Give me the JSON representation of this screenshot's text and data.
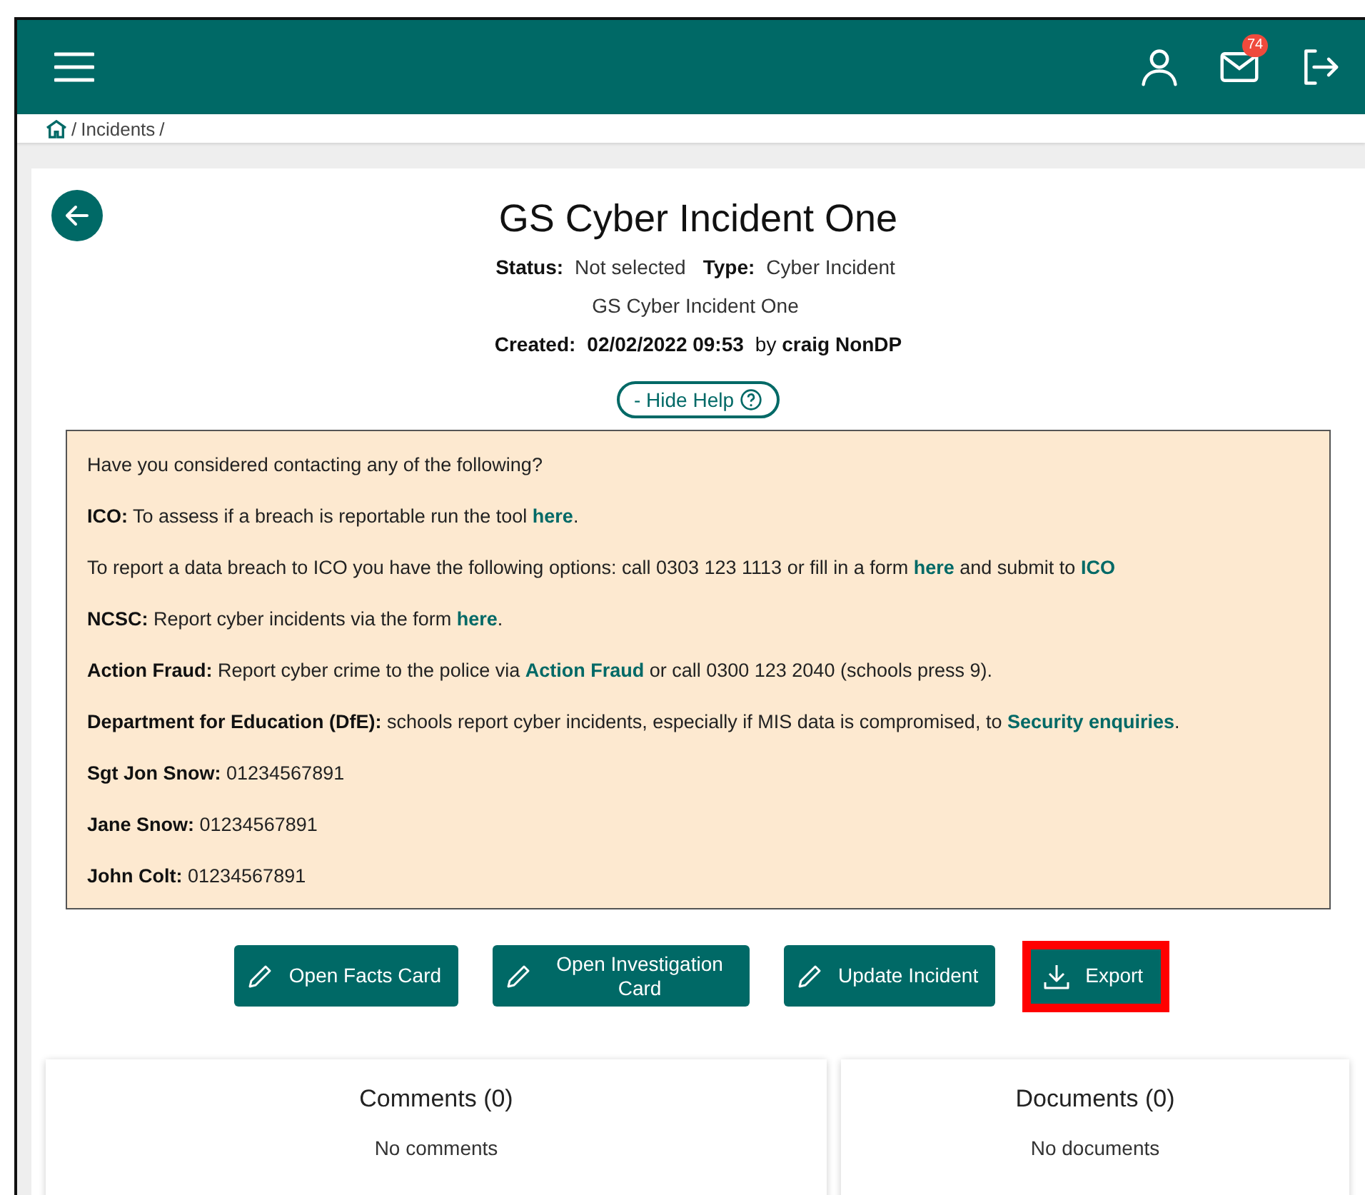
{
  "header": {
    "mail_badge": "74"
  },
  "breadcrumb": {
    "separator": "/",
    "items": [
      "Incidents"
    ]
  },
  "incident": {
    "title": "GS Cyber Incident One",
    "status_label": "Status:",
    "status": "Not selected",
    "type_label": "Type:",
    "type": "Cyber Incident",
    "description": "GS Cyber Incident One",
    "created_label": "Created:",
    "created": "02/02/2022 09:53",
    "by": "by",
    "author": "craig NonDP"
  },
  "help_toggle": "- Hide Help",
  "help": [
    [
      {
        "kind": "text",
        "text": "Have you considered contacting any of the following?"
      }
    ],
    [
      {
        "kind": "bold",
        "text": "ICO:"
      },
      {
        "kind": "text",
        "text": " To assess if a breach is reportable run the tool "
      },
      {
        "kind": "link",
        "text": "here"
      },
      {
        "kind": "text",
        "text": "."
      }
    ],
    [
      {
        "kind": "text",
        "text": "To report a data breach to ICO you have the following options: call 0303 123 1113 or fill in a form "
      },
      {
        "kind": "link",
        "text": "here"
      },
      {
        "kind": "text",
        "text": " and submit to "
      },
      {
        "kind": "link",
        "text": "ICO"
      }
    ],
    [
      {
        "kind": "bold",
        "text": "NCSC:"
      },
      {
        "kind": "text",
        "text": " Report cyber incidents via the form "
      },
      {
        "kind": "link",
        "text": "here"
      },
      {
        "kind": "text",
        "text": "."
      }
    ],
    [
      {
        "kind": "bold",
        "text": "Action Fraud:"
      },
      {
        "kind": "text",
        "text": " Report cyber crime to the police via "
      },
      {
        "kind": "link",
        "text": "Action Fraud"
      },
      {
        "kind": "text",
        "text": " or call 0300 123 2040 (schools press 9)."
      }
    ],
    [
      {
        "kind": "bold",
        "text": "Department for Education (DfE):"
      },
      {
        "kind": "text",
        "text": " schools report cyber incidents, especially if MIS data is compromised, to "
      },
      {
        "kind": "link",
        "text": "Security enquiries"
      },
      {
        "kind": "text",
        "text": "."
      }
    ],
    [
      {
        "kind": "bold",
        "text": "Sgt Jon Snow:"
      },
      {
        "kind": "text",
        "text": " 01234567891"
      }
    ],
    [
      {
        "kind": "bold",
        "text": "Jane Snow:"
      },
      {
        "kind": "text",
        "text": " 01234567891"
      }
    ],
    [
      {
        "kind": "bold",
        "text": "John Colt:"
      },
      {
        "kind": "text",
        "text": " 01234567891"
      }
    ]
  ],
  "actions": [
    {
      "kind": "edit",
      "label": "Open Facts Card",
      "highlighted": false
    },
    {
      "kind": "edit",
      "label": "Open Investigation Card",
      "highlighted": false
    },
    {
      "kind": "edit",
      "label": "Update Incident",
      "highlighted": false
    },
    {
      "kind": "download",
      "label": "Export",
      "highlighted": true
    }
  ],
  "panels": [
    {
      "title": "Comments (0)",
      "empty": "No comments"
    },
    {
      "title": "Documents (0)",
      "empty": "No documents"
    }
  ]
}
